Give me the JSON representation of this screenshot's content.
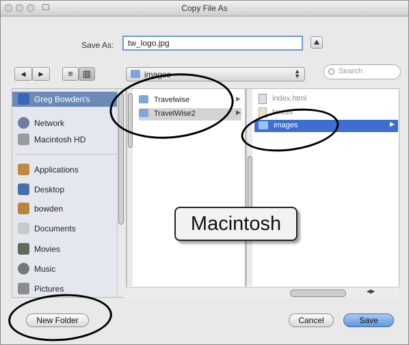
{
  "window": {
    "title": "Copy File As"
  },
  "save_as": {
    "label": "Save As:",
    "value": "tw_logo.jpg"
  },
  "toolbar": {
    "back_glyph": "◀",
    "forward_glyph": "▶",
    "list_view_glyph": "≡",
    "column_view_glyph": "▥",
    "location": "images",
    "search_placeholder": "Search"
  },
  "sidebar": {
    "items": [
      {
        "label": "Greg Bowden's",
        "icon": "computer-icon",
        "selected": true,
        "color": "#3a66b8"
      },
      {
        "label": "Network",
        "icon": "globe-icon",
        "selected": false,
        "color": "#6f7ea0"
      },
      {
        "label": "Macintosh HD",
        "icon": "harddisk-icon",
        "selected": false,
        "color": "#9a9a9a"
      },
      {
        "label": "Applications",
        "icon": "applications-icon",
        "selected": false,
        "color": "#c08a3e"
      },
      {
        "label": "Desktop",
        "icon": "desktop-icon",
        "selected": false,
        "color": "#4a6fa8"
      },
      {
        "label": "bowden",
        "icon": "home-icon",
        "selected": false,
        "color": "#b8863a"
      },
      {
        "label": "Documents",
        "icon": "documents-icon",
        "selected": false,
        "color": "#c9c9c9"
      },
      {
        "label": "Movies",
        "icon": "movies-icon",
        "selected": false,
        "color": "#5c6b5c"
      },
      {
        "label": "Music",
        "icon": "music-icon",
        "selected": false,
        "color": "#777777"
      },
      {
        "label": "Pictures",
        "icon": "pictures-icon",
        "selected": false,
        "color": "#8c8c8c"
      }
    ]
  },
  "column1": {
    "items": [
      {
        "label": "Travelwise",
        "selected": false
      },
      {
        "label": "TravelWise2",
        "selected": true
      }
    ]
  },
  "column2": {
    "items": [
      {
        "label": "index.html",
        "icon": "html-file-icon",
        "folder": false,
        "selected": false
      },
      {
        "label": "tw.css",
        "icon": "css-file-icon",
        "folder": false,
        "selected": false
      },
      {
        "label": "images",
        "icon": "folder-icon",
        "folder": true,
        "selected": true
      }
    ]
  },
  "annotation": {
    "label": "Macintosh"
  },
  "buttons": {
    "new_folder": "New Folder",
    "cancel": "Cancel",
    "save": "Save"
  },
  "colors": {
    "selection": "#3d6fd1",
    "sidebar_selection": "#6c8ab8",
    "annotation_stroke": "#000000",
    "default_button": "#7fb0e8"
  }
}
